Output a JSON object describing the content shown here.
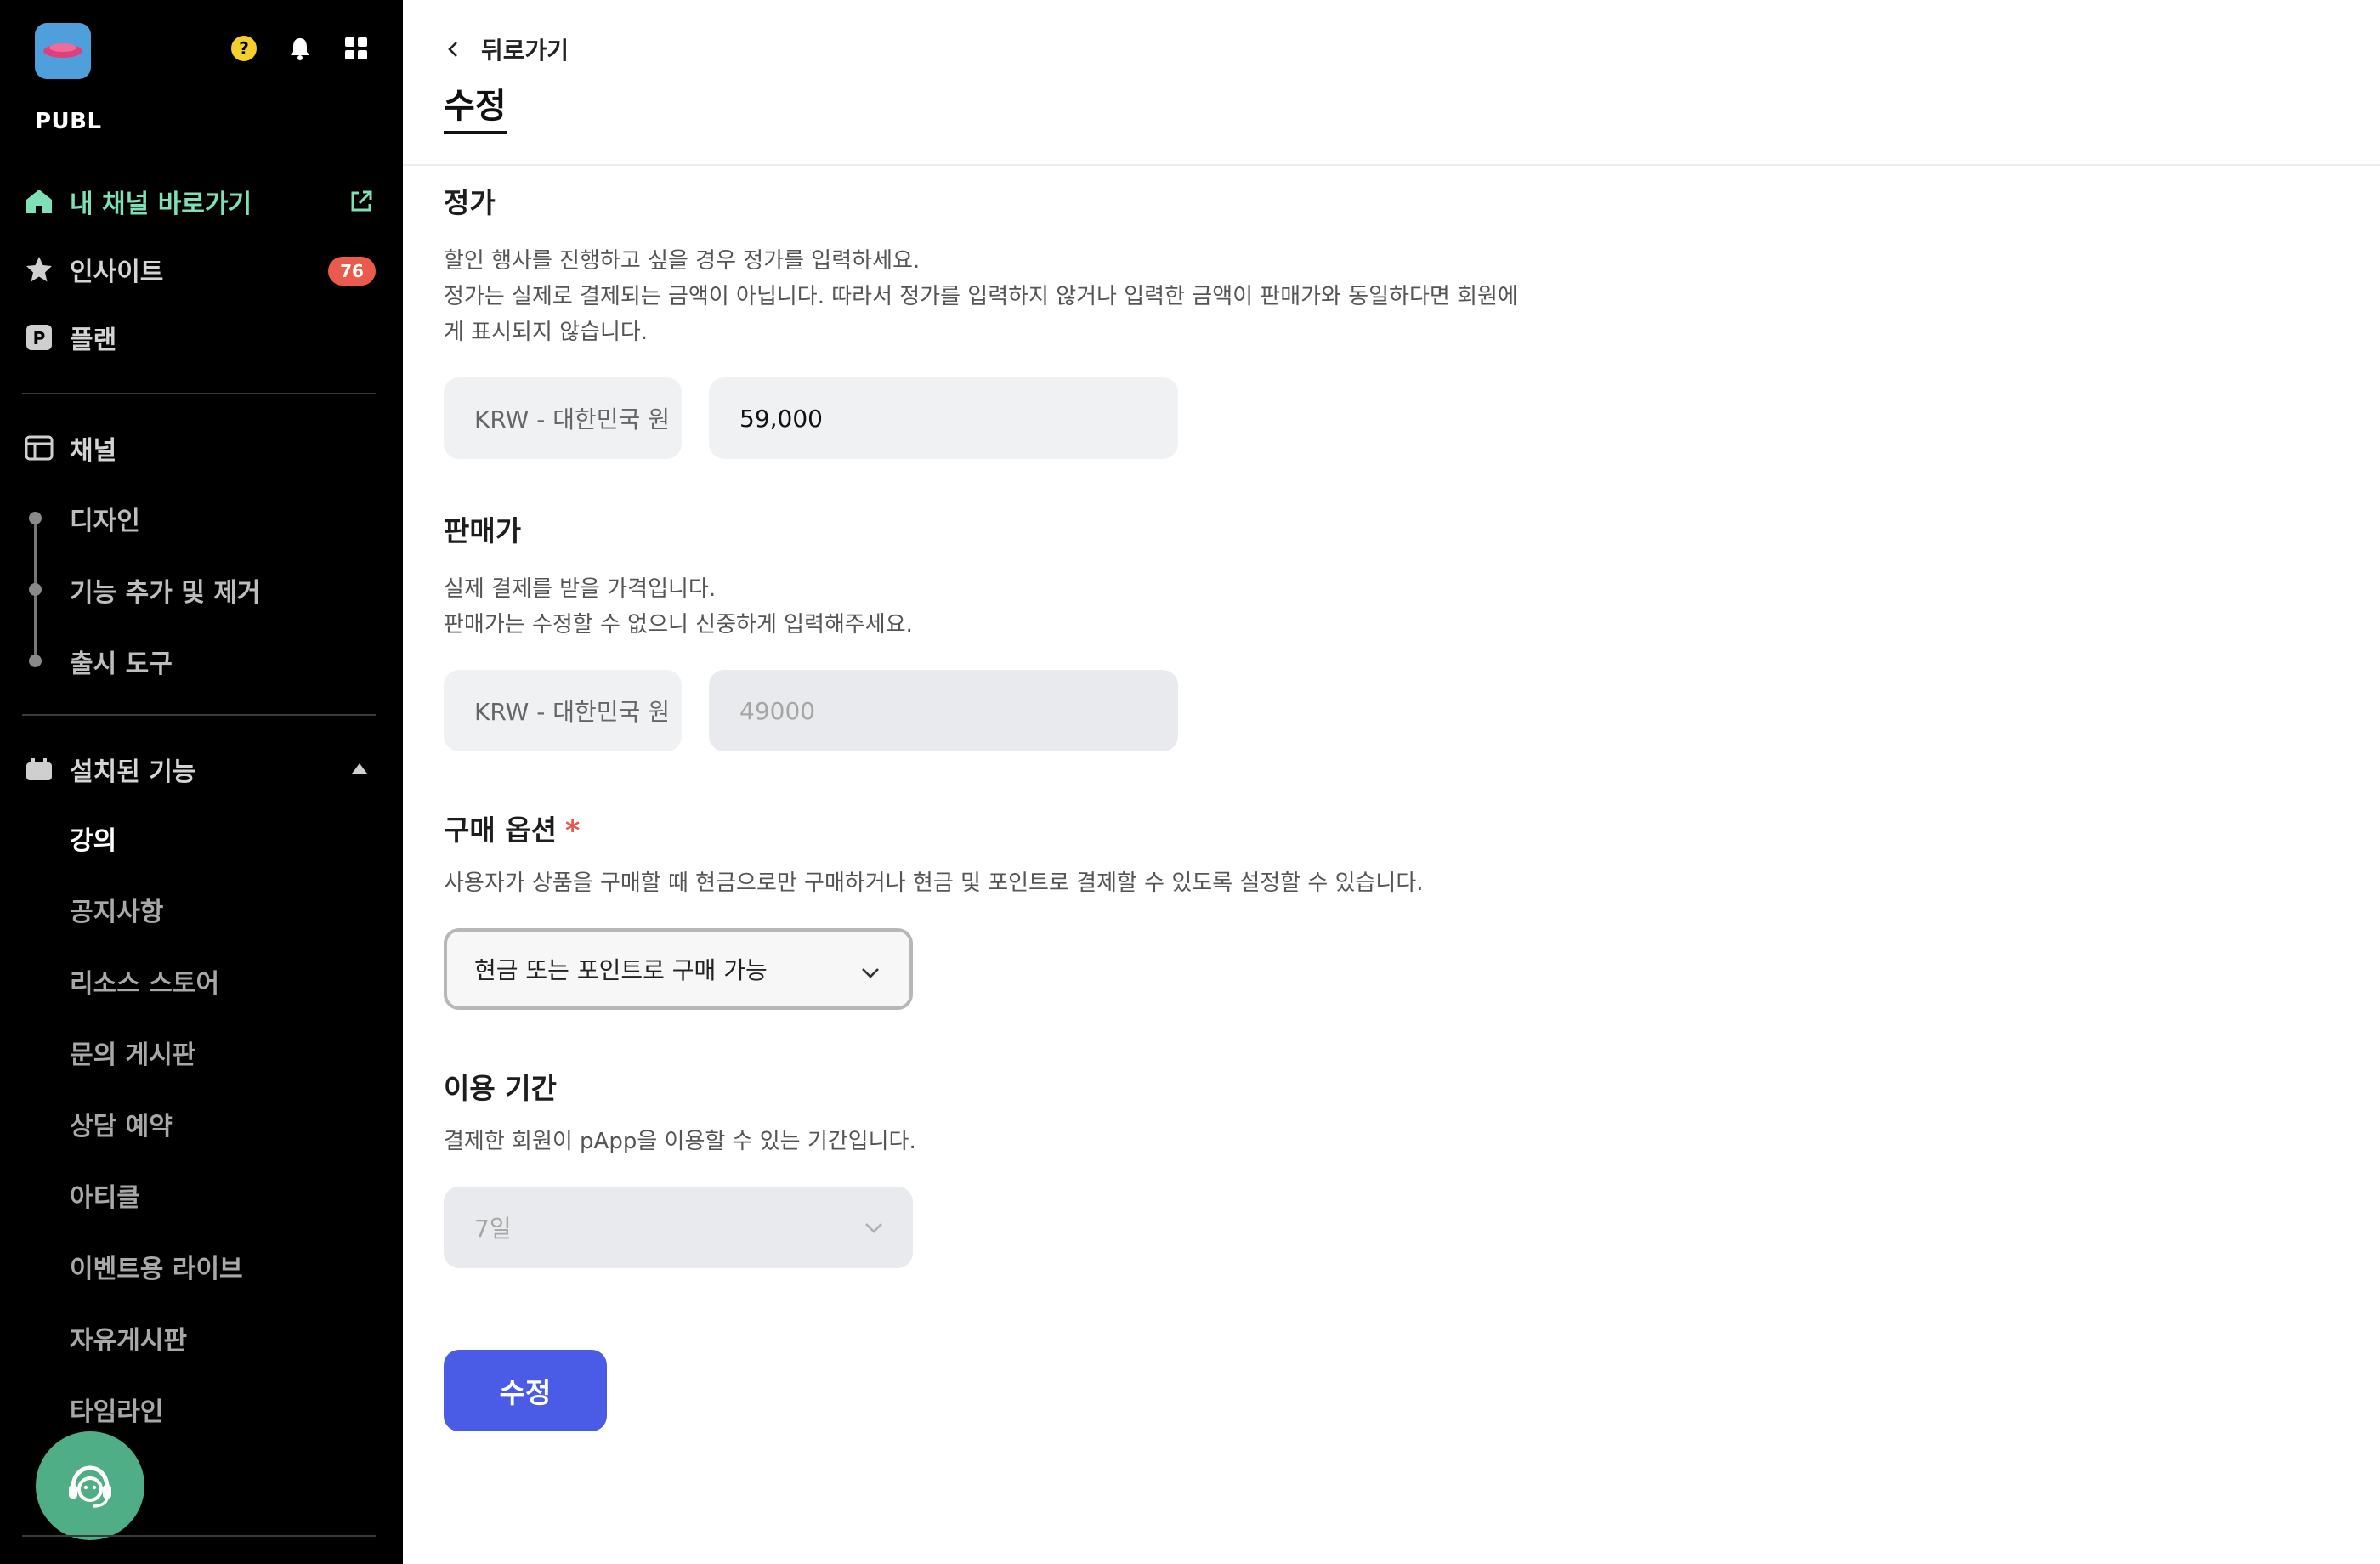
{
  "sidebar": {
    "brand": "PUBL",
    "nav": {
      "my_channel": "내 채널 바로가기",
      "insight": "인사이트",
      "insight_badge": "76",
      "plan": "플랜",
      "channel": "채널"
    },
    "channel_sub": [
      "디자인",
      "기능 추가 및 제거",
      "출시 도구"
    ],
    "installed_header": "설치된 기능",
    "installed_items": [
      "강의",
      "공지사항",
      "리소스 스토어",
      "문의 게시판",
      "상담 예약",
      "아티클",
      "이벤트용 라이브",
      "자유게시판",
      "타임라인"
    ],
    "colors": {
      "active": "#7ee0b4",
      "badge": "#ea5a4d",
      "support": "#4fae85"
    }
  },
  "header": {
    "back_label": "뒤로가기",
    "title": "수정"
  },
  "list_price": {
    "title": "정가",
    "desc_lines": [
      "할인 행사를 진행하고 싶을 경우 정가를 입력하세요.",
      "정가는 실제로 결제되는 금액이 아닙니다. 따라서 정가를 입력하지 않거나 입력한 금액이 판매가와 동일하다면 회원에",
      "게 표시되지 않습니다."
    ],
    "currency": "KRW - 대한민국 원",
    "value": "59,000"
  },
  "sale_price": {
    "title": "판매가",
    "desc_lines": [
      "실제 결제를 받을 가격입니다.",
      "판매가는 수정할 수 없으니 신중하게 입력해주세요."
    ],
    "currency": "KRW - 대한민국 원",
    "value": "49000"
  },
  "purchase_option": {
    "title": "구매 옵션",
    "required_mark": "*",
    "desc": "사용자가 상품을 구매할 때 현금으로만 구매하거나 현금 및 포인트로 결제할 수 있도록 설정할 수 있습니다.",
    "selected": "현금 또는 포인트로 구매 가능"
  },
  "period": {
    "title": "이용 기간",
    "desc": "결제한 회원이 pApp을 이용할 수 있는 기간입니다.",
    "selected": "7일"
  },
  "submit_label": "수정",
  "colors": {
    "primary": "#4a5ce6",
    "required": "#e25b4c"
  }
}
